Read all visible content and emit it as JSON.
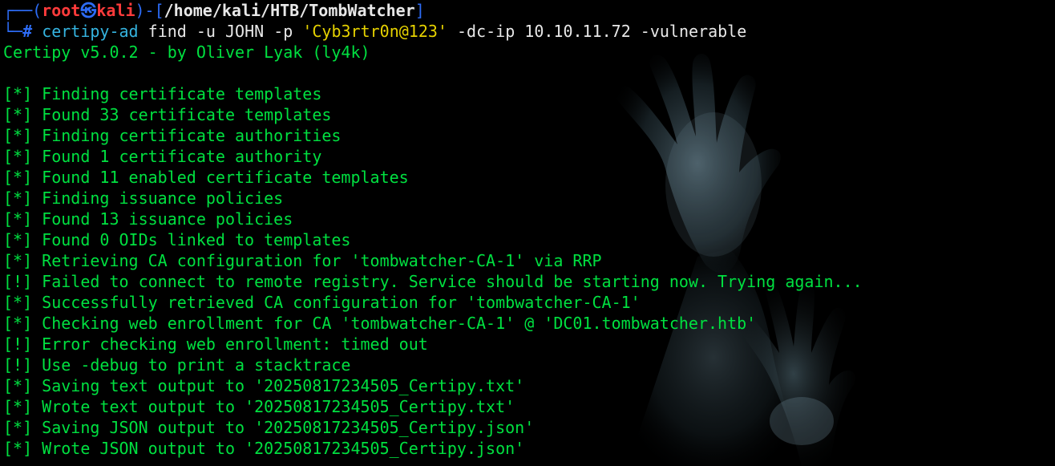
{
  "prompt": {
    "top_left": "┌──(",
    "user": "root",
    "at_icon": "㉿",
    "host": "kali",
    "sep_open": ")-[",
    "path": "/home/kali/HTB/TombWatcher",
    "sep_close": "]",
    "bottom_left": "└─",
    "hash": "#"
  },
  "command": {
    "program": "certipy-ad",
    "args_1": "find -u JOHN -p",
    "password": "'Cyb3rtr0n@123'",
    "args_2": "-dc-ip 10.10.11.72 -vulnerable"
  },
  "banner": "Certipy v5.0.2 - by Oliver Lyak (ly4k)",
  "output_lines": [
    "[*] Finding certificate templates",
    "[*] Found 33 certificate templates",
    "[*] Finding certificate authorities",
    "[*] Found 1 certificate authority",
    "[*] Found 11 enabled certificate templates",
    "[*] Finding issuance policies",
    "[*] Found 13 issuance policies",
    "[*] Found 0 OIDs linked to templates",
    "[*] Retrieving CA configuration for 'tombwatcher-CA-1' via RRP",
    "[!] Failed to connect to remote registry. Service should be starting now. Trying again...",
    "[*] Successfully retrieved CA configuration for 'tombwatcher-CA-1'",
    "[*] Checking web enrollment for CA 'tombwatcher-CA-1' @ 'DC01.tombwatcher.htb'",
    "[!] Error checking web enrollment: timed out",
    "[!] Use -debug to print a stacktrace",
    "[*] Saving text output to '20250817234505_Certipy.txt'",
    "[*] Wrote text output to '20250817234505_Certipy.txt'",
    "[*] Saving JSON output to '20250817234505_Certipy.json'",
    "[*] Wrote JSON output to '20250817234505_Certipy.json'"
  ],
  "colors": {
    "background": "#000000",
    "output_green": "#00e040",
    "prompt_blue": "#2d6cf6",
    "user_red": "#ff3b3b",
    "password_yellow": "#e6d200",
    "command_cyan": "#35b4e0"
  },
  "icons": {
    "wallpaper": "reaching-hands-wallpaper"
  }
}
